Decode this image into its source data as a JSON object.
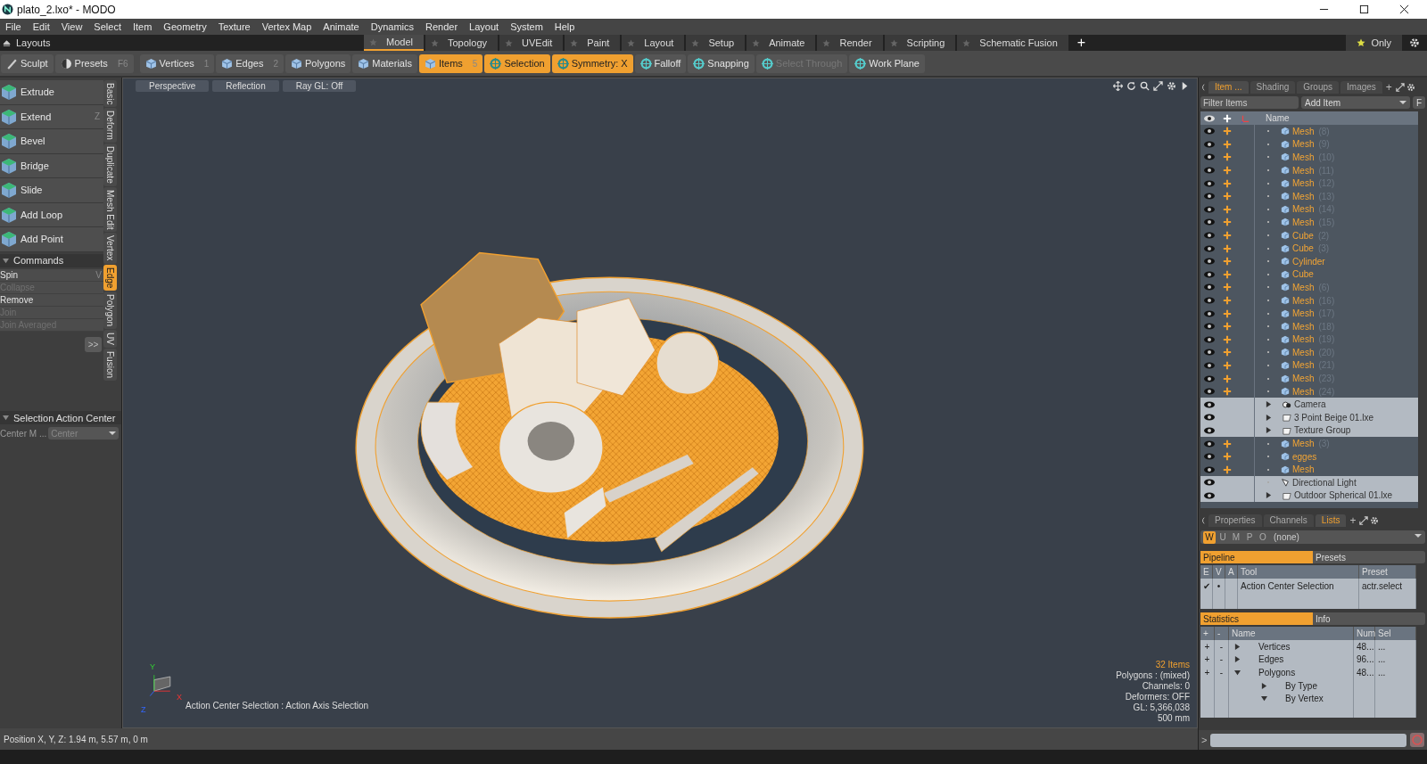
{
  "window": {
    "title": "plato_2.lxo* - MODO"
  },
  "menu": [
    "File",
    "Edit",
    "View",
    "Select",
    "Item",
    "Geometry",
    "Texture",
    "Vertex Map",
    "Animate",
    "Dynamics",
    "Render",
    "Layout",
    "System",
    "Help"
  ],
  "layouts": {
    "label": "Layouts",
    "tabs": [
      {
        "label": "Model",
        "selected": true
      },
      {
        "label": "Topology",
        "selected": false
      },
      {
        "label": "UVEdit",
        "selected": false
      },
      {
        "label": "Paint",
        "selected": false
      },
      {
        "label": "Layout",
        "selected": false
      },
      {
        "label": "Setup",
        "selected": false
      },
      {
        "label": "Animate",
        "selected": false
      },
      {
        "label": "Render",
        "selected": false
      },
      {
        "label": "Scripting",
        "selected": false
      },
      {
        "label": "Schematic Fusion",
        "selected": false
      }
    ],
    "add": "+",
    "only": "Only"
  },
  "toolbar": {
    "left": [
      {
        "label": "Sculpt"
      },
      {
        "label": "Presets",
        "shortcut": "F6"
      }
    ],
    "modes": [
      {
        "label": "Vertices",
        "shortcut": "1",
        "selected": false
      },
      {
        "label": "Edges",
        "shortcut": "2",
        "selected": false
      },
      {
        "label": "Polygons",
        "selected": false
      },
      {
        "label": "Materials",
        "selected": false
      },
      {
        "label": "Items",
        "shortcut": "5",
        "selected": true
      }
    ],
    "options": [
      {
        "label": "Selection",
        "selected": true,
        "disabled": false
      },
      {
        "label": "Symmetry: X",
        "selected": true,
        "disabled": false
      },
      {
        "label": "Falloff",
        "selected": false,
        "disabled": false
      },
      {
        "label": "Snapping",
        "selected": false,
        "disabled": false
      },
      {
        "label": "Select Through",
        "selected": false,
        "disabled": true
      },
      {
        "label": "Work Plane",
        "selected": false,
        "disabled": false
      }
    ]
  },
  "tools": [
    {
      "label": "Extrude"
    },
    {
      "label": "Extend",
      "shortcut": "Z"
    },
    {
      "label": "Bevel"
    },
    {
      "label": "Bridge"
    },
    {
      "label": "Slide"
    },
    {
      "label": "Add Loop"
    },
    {
      "label": "Add Point"
    }
  ],
  "side_tabs": [
    {
      "label": "Basic",
      "selected": false
    },
    {
      "label": "Deform",
      "selected": false
    },
    {
      "label": "Duplicate",
      "selected": false
    },
    {
      "label": "Mesh Edit",
      "selected": false
    },
    {
      "label": "Vertex",
      "selected": false
    },
    {
      "label": "Edge",
      "selected": true
    },
    {
      "label": "Polygon",
      "selected": false
    },
    {
      "label": "UV",
      "selected": false
    },
    {
      "label": "Fusion",
      "selected": false
    }
  ],
  "commands": {
    "title": "Commands",
    "items": [
      {
        "label": "Spin",
        "shortcut": "V",
        "disabled": false
      },
      {
        "label": "Collapse",
        "disabled": true
      },
      {
        "label": "Remove",
        "disabled": false
      },
      {
        "label": "Join",
        "disabled": true
      },
      {
        "label": "Join Averaged",
        "disabled": true
      }
    ],
    "more": ">>"
  },
  "action_center": {
    "title": "Selection Action Center",
    "field_label": "Center M ...",
    "value": "Center"
  },
  "viewport": {
    "buttons": [
      "Perspective",
      "Reflection",
      "Ray GL: Off"
    ],
    "axes": [
      "Y",
      "X",
      "Z"
    ],
    "message": "Action Center Selection : Action Axis Selection",
    "stats": [
      {
        "text": "32 Items",
        "highlight": true
      },
      {
        "text": "Polygons : (mixed)",
        "highlight": false
      },
      {
        "text": "Channels: 0",
        "highlight": false
      },
      {
        "text": "Deformers: OFF",
        "highlight": false
      },
      {
        "text": "GL: 5,366,038",
        "highlight": false
      },
      {
        "text": "500 mm",
        "highlight": false
      }
    ]
  },
  "status_bar": "Position X, Y, Z:  1.94 m, 5.57 m, 0 m",
  "item_list": {
    "tabs": [
      {
        "label": "Item ...",
        "selected": true
      },
      {
        "label": "Shading",
        "selected": false
      },
      {
        "label": "Groups",
        "selected": false
      },
      {
        "label": "Images",
        "selected": false
      }
    ],
    "add": "+",
    "filter_placeholder": "Filter Items",
    "add_item": "Add Item",
    "f_button": "F",
    "name_column": "Name",
    "rows": [
      {
        "name": "Mesh",
        "suffix": "(8)",
        "kind": "mesh",
        "selected": true,
        "expandable": false
      },
      {
        "name": "Mesh",
        "suffix": "(9)",
        "kind": "mesh",
        "selected": true,
        "expandable": false
      },
      {
        "name": "Mesh",
        "suffix": "(10)",
        "kind": "mesh",
        "selected": true,
        "expandable": false
      },
      {
        "name": "Mesh",
        "suffix": "(11)",
        "kind": "mesh",
        "selected": true,
        "expandable": false
      },
      {
        "name": "Mesh",
        "suffix": "(12)",
        "kind": "mesh",
        "selected": true,
        "expandable": false
      },
      {
        "name": "Mesh",
        "suffix": "(13)",
        "kind": "mesh",
        "selected": true,
        "expandable": false
      },
      {
        "name": "Mesh",
        "suffix": "(14)",
        "kind": "mesh",
        "selected": true,
        "expandable": false
      },
      {
        "name": "Mesh",
        "suffix": "(15)",
        "kind": "mesh",
        "selected": true,
        "expandable": false
      },
      {
        "name": "Cube",
        "suffix": "(2)",
        "kind": "mesh",
        "selected": true,
        "expandable": false
      },
      {
        "name": "Cube",
        "suffix": "(3)",
        "kind": "mesh",
        "selected": true,
        "expandable": false
      },
      {
        "name": "Cylinder",
        "kind": "mesh",
        "selected": true,
        "expandable": false
      },
      {
        "name": "Cube",
        "kind": "mesh",
        "selected": true,
        "expandable": false
      },
      {
        "name": "Mesh",
        "suffix": "(6)",
        "kind": "mesh",
        "selected": true,
        "expandable": false
      },
      {
        "name": "Mesh",
        "suffix": "(16)",
        "kind": "mesh",
        "selected": true,
        "expandable": false
      },
      {
        "name": "Mesh",
        "suffix": "(17)",
        "kind": "mesh",
        "selected": true,
        "expandable": false
      },
      {
        "name": "Mesh",
        "suffix": "(18)",
        "kind": "mesh",
        "selected": true,
        "expandable": false
      },
      {
        "name": "Mesh",
        "suffix": "(19)",
        "kind": "mesh",
        "selected": true,
        "expandable": false
      },
      {
        "name": "Mesh",
        "suffix": "(20)",
        "kind": "mesh",
        "selected": true,
        "expandable": false
      },
      {
        "name": "Mesh",
        "suffix": "(21)",
        "kind": "mesh",
        "selected": true,
        "expandable": false
      },
      {
        "name": "Mesh",
        "suffix": "(23)",
        "kind": "mesh",
        "selected": true,
        "expandable": false
      },
      {
        "name": "Mesh",
        "suffix": "(24)",
        "kind": "mesh",
        "selected": true,
        "expandable": false
      },
      {
        "name": "Camera",
        "kind": "camera",
        "selected": false,
        "expandable": true
      },
      {
        "name": "3 Point Beige 01.lxe",
        "kind": "group",
        "selected": false,
        "expandable": true
      },
      {
        "name": "Texture Group",
        "kind": "group",
        "selected": false,
        "expandable": true
      },
      {
        "name": "Mesh",
        "suffix": "(3)",
        "kind": "mesh",
        "selected": true,
        "expandable": false
      },
      {
        "name": "egges",
        "kind": "mesh",
        "selected": true,
        "expandable": false
      },
      {
        "name": "Mesh",
        "kind": "mesh",
        "selected": true,
        "expandable": false
      },
      {
        "name": "Directional Light",
        "kind": "light",
        "selected": false,
        "expandable": false
      },
      {
        "name": "Outdoor Spherical 01.lxe",
        "kind": "group",
        "selected": false,
        "expandable": true
      }
    ]
  },
  "lists": {
    "tabs": [
      {
        "label": "Properties",
        "selected": false
      },
      {
        "label": "Channels",
        "selected": false
      },
      {
        "label": "Lists",
        "selected": true
      }
    ],
    "add": "+",
    "filters": [
      {
        "label": "W",
        "selected": true
      },
      {
        "label": "U",
        "selected": false
      },
      {
        "label": "M",
        "selected": false
      },
      {
        "label": "P",
        "selected": false
      },
      {
        "label": "O",
        "selected": false
      }
    ],
    "dropdown": "(none)",
    "pipeline_tabs": [
      {
        "label": "Pipeline",
        "selected": true
      },
      {
        "label": "Presets",
        "selected": false
      }
    ],
    "pipeline_columns": [
      "E",
      "V",
      "A",
      "Tool",
      "Preset"
    ],
    "pipeline_rows": [
      {
        "enabled": "✔",
        "visible": "•",
        "tool": "Action Center Selection",
        "preset": "actr.select"
      }
    ],
    "stats_tabs": [
      {
        "label": "Statistics",
        "selected": true
      },
      {
        "label": "Info",
        "selected": false
      }
    ],
    "stats_columns": [
      "+",
      "-",
      "Name",
      "Num",
      "Sel"
    ],
    "stats_rows": [
      {
        "plus": "+",
        "minus": "-",
        "name": "Vertices",
        "num": "48...",
        "sel": "...",
        "expanded": false,
        "children": []
      },
      {
        "plus": "+",
        "minus": "-",
        "name": "Edges",
        "num": "96...",
        "sel": "...",
        "expanded": false,
        "children": []
      },
      {
        "plus": "+",
        "minus": "-",
        "name": "Polygons",
        "num": "48...",
        "sel": "...",
        "expanded": true,
        "children": [
          {
            "name": "By Type",
            "expanded": false
          },
          {
            "name": "By Vertex",
            "expanded": true
          }
        ]
      }
    ],
    "command_prompt": ">"
  }
}
